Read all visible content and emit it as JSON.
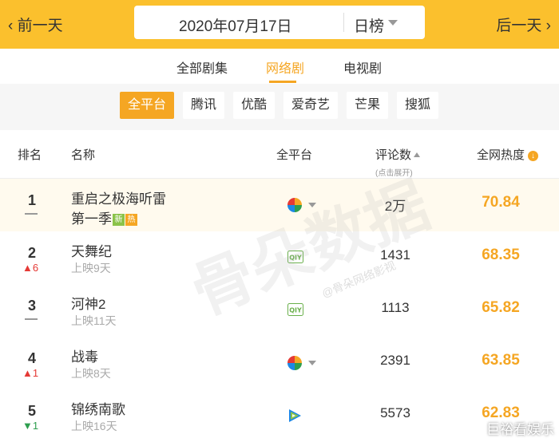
{
  "nav": {
    "prev": "前一天",
    "next": "后一天",
    "date": "2020年07月17日",
    "period": "日榜"
  },
  "tabs": [
    "全部剧集",
    "网络剧",
    "电视剧"
  ],
  "platforms": [
    "全平台",
    "腾讯",
    "优酷",
    "爱奇艺",
    "芒果",
    "搜狐"
  ],
  "header": {
    "rank": "排名",
    "name": "名称",
    "platform": "全平台",
    "comments": "评论数",
    "hint": "(点击展开)",
    "heat": "全网热度"
  },
  "rows": [
    {
      "rank": "1",
      "title": "重启之极海听雷",
      "subtitle": "第一季",
      "tags": [
        "新",
        "热"
      ],
      "platform_icon": "multi-platform-icon",
      "comments": "2万",
      "heat": "70.84"
    },
    {
      "rank": "2",
      "change": "6",
      "direction": "up",
      "title": "天舞纪",
      "subtitle": "上映9天",
      "platform_icon": "iqiyi-icon",
      "comments": "1431",
      "heat": "68.35"
    },
    {
      "rank": "3",
      "title": "河神2",
      "subtitle": "上映11天",
      "platform_icon": "iqiyi-icon",
      "comments": "1113",
      "heat": "65.82"
    },
    {
      "rank": "4",
      "change": "1",
      "direction": "up",
      "title": "战毒",
      "subtitle": "上映8天",
      "platform_icon": "multi-platform-icon",
      "comments": "2391",
      "heat": "63.85"
    },
    {
      "rank": "5",
      "change": "1",
      "direction": "down",
      "title": "锦绣南歌",
      "subtitle": "上映16天",
      "platform_icon": "tencent-video-icon",
      "comments": "5573",
      "heat": "62.83"
    }
  ],
  "watermark": {
    "main": "骨朵数据",
    "small": "@骨朵网络影视",
    "corner": "巨裕看娱乐"
  },
  "colors": {
    "accent": "#f5a623",
    "topbar": "#fbc02d",
    "up": "#e53935",
    "down": "#2e9e4f"
  }
}
